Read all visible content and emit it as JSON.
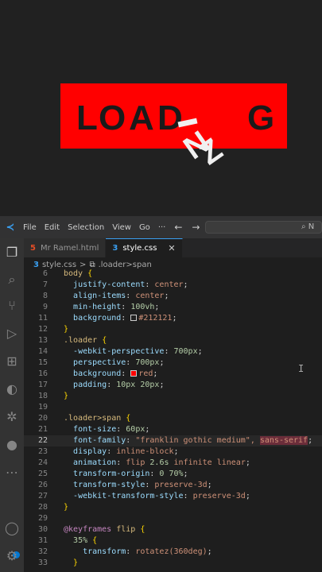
{
  "preview": {
    "letters": [
      "L",
      "O",
      "A",
      "D",
      "N",
      "Z",
      "G"
    ],
    "loader_bg": "#ff0000",
    "page_bg": "#212121"
  },
  "menu": [
    "File",
    "Edit",
    "Selection",
    "View",
    "Go",
    "···"
  ],
  "nav": {
    "back": "←",
    "forward": "→"
  },
  "search": {
    "text": "N"
  },
  "tabs": [
    {
      "icon": "5",
      "label": "Mr Ramel.html",
      "active": false
    },
    {
      "icon": "3",
      "label": "style.css",
      "active": true,
      "close": "✕"
    }
  ],
  "breadcrumb": {
    "file": "style.css",
    "sep": ">",
    "symbol": ".loader>span"
  },
  "code_lines": [
    {
      "n": "6",
      "text": "body {"
    },
    {
      "n": "7",
      "text": "  justify-content: center;"
    },
    {
      "n": "8",
      "text": "  align-items: center;"
    },
    {
      "n": "9",
      "text": "  min-height: 100vh;"
    },
    {
      "n": "11",
      "text": "  background: #212121;"
    },
    {
      "n": "12",
      "text": "}"
    },
    {
      "n": "13",
      "text": ".loader {"
    },
    {
      "n": "14",
      "text": "  -webkit-perspective: 700px;"
    },
    {
      "n": "15",
      "text": "  perspective: 700px;"
    },
    {
      "n": "16",
      "text": "  background: red;"
    },
    {
      "n": "17",
      "text": "  padding: 10px 20px;"
    },
    {
      "n": "18",
      "text": "}"
    },
    {
      "n": "19",
      "text": ""
    },
    {
      "n": "20",
      "text": ".loader>span {"
    },
    {
      "n": "21",
      "text": "  font-size: 60px;"
    },
    {
      "n": "22",
      "text": "  font-family: \"franklin gothic medium\", sans-serif;"
    },
    {
      "n": "23",
      "text": "  display: inline-block;"
    },
    {
      "n": "24",
      "text": "  animation: flip 2.6s infinite linear;"
    },
    {
      "n": "25",
      "text": "  transform-origin: 0 70%;"
    },
    {
      "n": "26",
      "text": "  transform-style: preserve-3d;"
    },
    {
      "n": "27",
      "text": "  -webkit-transform-style: preserve-3d;"
    },
    {
      "n": "28",
      "text": "}"
    },
    {
      "n": "29",
      "text": ""
    },
    {
      "n": "30",
      "text": "@keyframes flip {"
    },
    {
      "n": "31",
      "text": "  35% {"
    },
    {
      "n": "32",
      "text": "    transform: rotatez(360deg);"
    },
    {
      "n": "33",
      "text": "  }"
    }
  ],
  "colors": {
    "accent": "#3aa0f2",
    "editor_bg": "#1e1e1e",
    "activity_bg": "#333333"
  }
}
